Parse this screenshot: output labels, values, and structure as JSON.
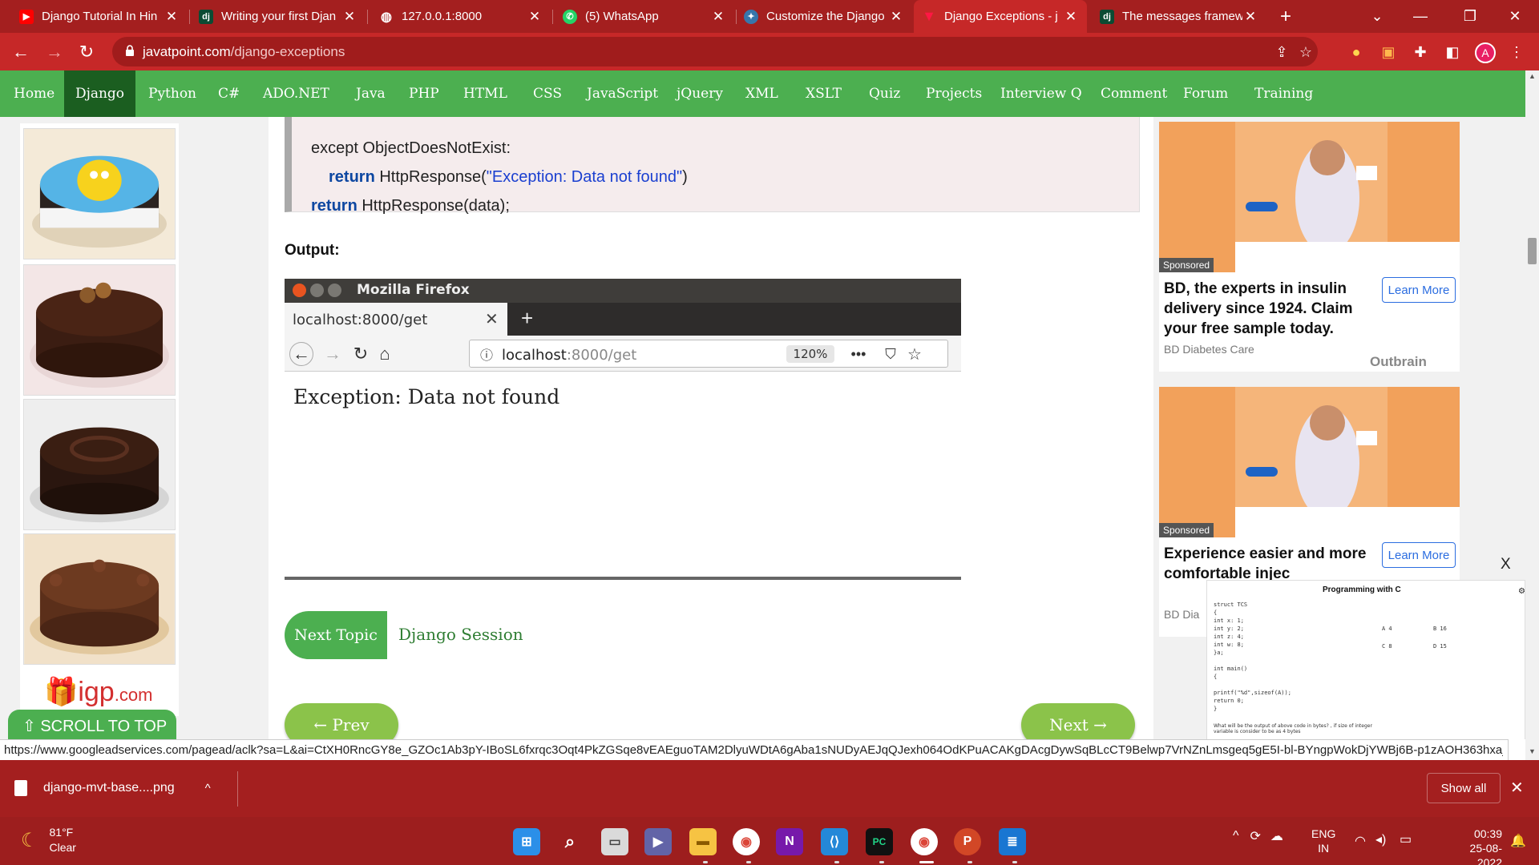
{
  "browser": {
    "tabs": [
      {
        "label": "Django Tutorial In Hin",
        "favicon": "youtube-icon",
        "color": "#ff0000"
      },
      {
        "label": "Writing your first Djan",
        "favicon": "django-icon",
        "color": "#0c4b33"
      },
      {
        "label": "127.0.0.1:8000",
        "favicon": "globe-icon",
        "color": "#ffffff"
      },
      {
        "label": "(5) WhatsApp",
        "favicon": "whatsapp-icon",
        "color": "#25d366"
      },
      {
        "label": "Customize the Django",
        "favicon": "python-icon",
        "color": "#3776ab"
      },
      {
        "label": "Django Exceptions - j",
        "favicon": "javatpoint-icon",
        "color": "#e53935",
        "active": true
      },
      {
        "label": "The messages framew",
        "favicon": "django-icon",
        "color": "#0c4b33"
      }
    ],
    "new_tab": "+",
    "url_host": "javatpoint.com",
    "url_path": "/django-exceptions",
    "profile_initial": "A",
    "status_url": "https://www.googleadservices.com/pagead/aclk?sa=L&ai=CtXH0RncGY8e_GZOc1Ab3pY-IBoSL6fxrqc3Oqt4PkZGSqe8vEAEguoTAM2DlyuWDtA6gAba1sNUDyAEJqQJexh064OdKPuACAKgDAcgDywSqBLcCT9Belwp7VrNZnLmsgeq5gE5I-bl-BYngpWokDjYWBj6B-p1zAOH363hxa_y0lIM..."
  },
  "site_nav": {
    "items": [
      "Home",
      "Django",
      "Python",
      "C#",
      "ADO.NET",
      "Java",
      "PHP",
      "HTML",
      "CSS",
      "JavaScript",
      "jQuery",
      "XML",
      "XSLT",
      "Quiz",
      "Projects",
      "Interview Q",
      "Comment",
      "Forum",
      "Training"
    ],
    "active": "Django",
    "accent": "#4caf50",
    "active_color": "#1b5e20"
  },
  "code": {
    "line1": "except ObjectDoesNotExist:",
    "line2_kw": "return",
    "line2_call": " HttpResponse(",
    "line2_str": "\"Exception: Data not found\"",
    "line2_end": ")",
    "line3_kw": "return",
    "line3_rest": " HttpResponse(data);"
  },
  "output": {
    "label": "Output:",
    "window_title": "Mozilla Firefox",
    "tab_label": "localhost:8000/get",
    "url_host": "localhost",
    "url_rest": ":8000/get",
    "zoom": "120%",
    "body_text": "Exception: Data not found"
  },
  "navigation": {
    "next_topic_label": "Next Topic",
    "next_topic_link": "Django Session",
    "prev": "← Prev",
    "next": "Next →"
  },
  "left_ad": {
    "brand": "igp",
    "brand_suffix": ".com",
    "scroll_to_top": "⇧ SCROLL TO TOP"
  },
  "right_ads": [
    {
      "sponsored": "Sponsored",
      "headline": "BD, the experts in insulin delivery since 1924. Claim your free sample today.",
      "cta": "Learn More",
      "source": "BD Diabetes Care"
    },
    {
      "sponsored": "Sponsored",
      "headline": "Experience easier and more comfortable injec",
      "cta": "Learn More",
      "source": "BD Dia"
    }
  ],
  "outbrain": "Outbrain",
  "ad_close": "X",
  "video": {
    "title": "Programming with C",
    "code_lines": [
      "struct TCS",
      "{",
      "  int x: 1;",
      "  int y: 2;",
      "  int z: 4;",
      "  int w: 8;",
      "}a;",
      "",
      "int main()",
      "{",
      "",
      "   printf(\"%d\",sizeof(A));",
      "   return 0;",
      "}"
    ],
    "footnote": "What will be the output of above code in bytes? , if size of integer variable is consider to be as 4 bytes",
    "options": [
      "A  4",
      "B  16",
      "C  8",
      "D  15"
    ]
  },
  "downloads": {
    "file": "django-mvt-base....png",
    "show_all": "Show all"
  },
  "taskbar": {
    "temp": "81°F",
    "condition": "Clear",
    "lang1": "ENG",
    "lang2": "IN",
    "time": "00:39",
    "date": "25-08-2022"
  }
}
